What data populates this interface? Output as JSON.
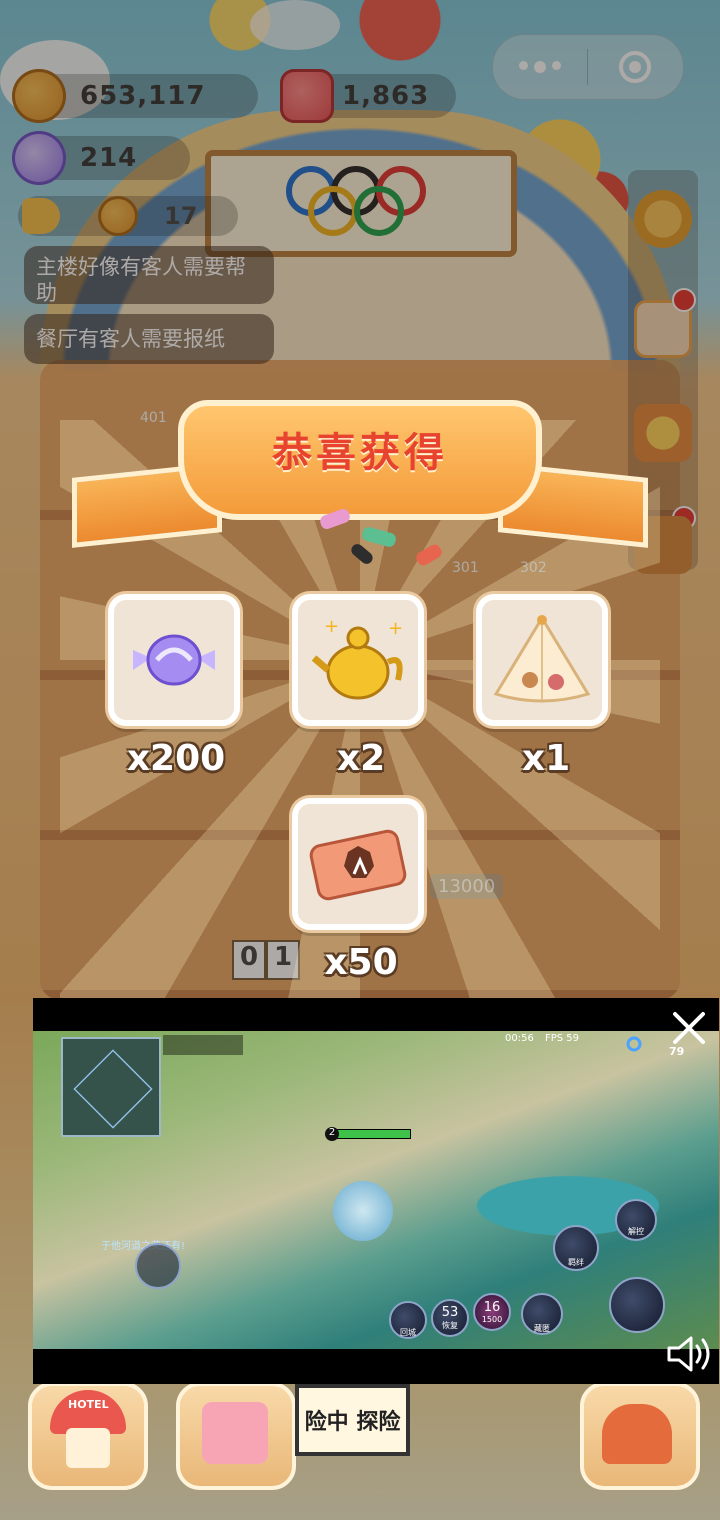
{
  "hud": {
    "cookies": "653,117",
    "jellies": "1,863",
    "candies": "214",
    "level": "17",
    "notices": [
      "主楼好像有客人需要帮助",
      "餐厅有客人需要报纸"
    ]
  },
  "scene": {
    "room_numbers": [
      "401",
      "301",
      "302",
      "13000"
    ],
    "counter": [
      "0",
      "1"
    ]
  },
  "popup": {
    "title": "恭喜获得",
    "rewards": [
      {
        "icon": "purple-candy-icon",
        "qty": "x200"
      },
      {
        "icon": "golden-teapot-icon",
        "qty": "x2"
      },
      {
        "icon": "tent-icon",
        "qty": "x1"
      },
      {
        "icon": "ticket-icon",
        "qty": "x50"
      }
    ]
  },
  "bottom_nav": {
    "hotel_label": "HOTEL",
    "adventure_label": "险中 探险"
  },
  "video": {
    "timer": "00:56",
    "fps": "FPS 59",
    "score": "79",
    "skills": {
      "recall": "回城",
      "heal_cd": "53",
      "heal": "恢复",
      "flash_cd": "16",
      "gold": "1500",
      "stealth": "藏匿",
      "unlock": "解控",
      "bond": "羁绊"
    },
    "player_level": "2",
    "chat_message": "于他河道之荣还有!"
  },
  "colors": {
    "accent_orange": "#f49b3a",
    "title_red": "#e8432e",
    "overlay": "#28201e"
  }
}
